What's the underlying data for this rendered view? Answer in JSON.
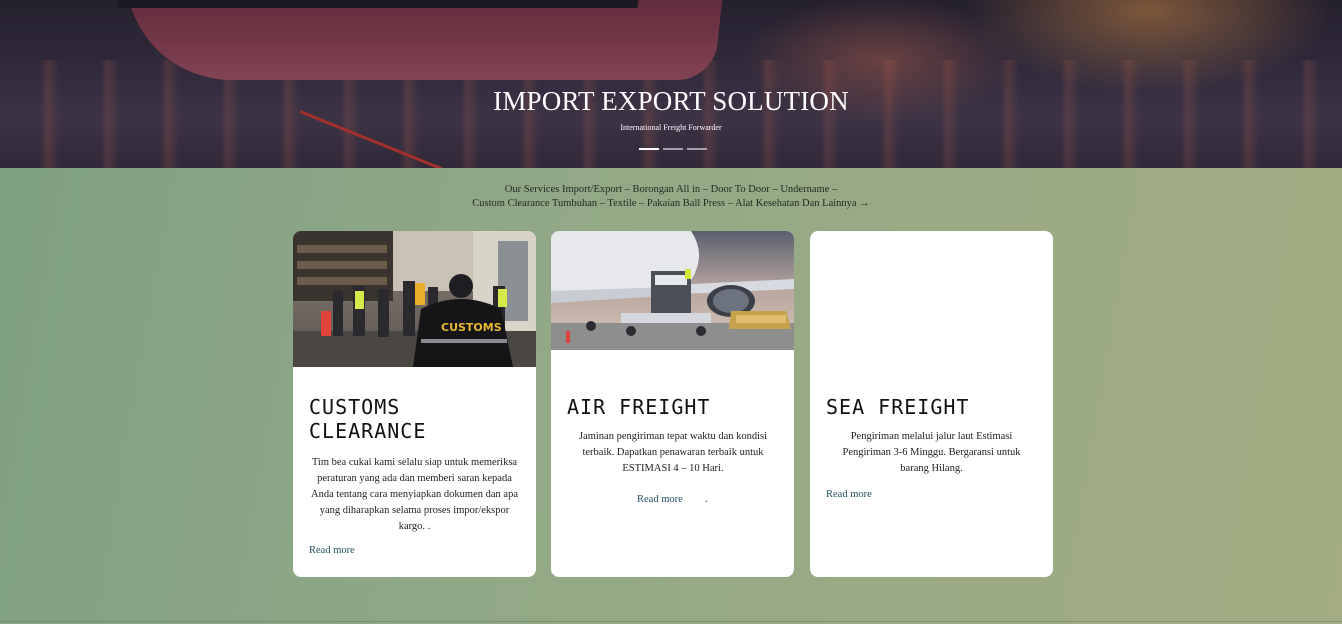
{
  "hero": {
    "title": "IMPORT EXPORT SOLUTION",
    "subtitle": "International Freight Forwarder",
    "slides": [
      true,
      false,
      false
    ]
  },
  "services": {
    "line1": "Our Services Import/Export – Borongan All in – Door To Door – Undername –",
    "line2": "Custom Clearance Tumbuhan – Textile – Pakaian Ball Press – Alat Kesehatan Dan Lainnya →"
  },
  "cards": [
    {
      "title_line1": "CUSTOMS",
      "title_line2": "CLEARANCE",
      "description": "Tim bea cukai kami selalu siap untuk memeriksa peraturan yang ada dan memberi saran kepada Anda tentang cara menyiapkan dokumen dan apa yang diharapkan selama proses impor/ekspor kargo. .",
      "link": "Read more",
      "badge": "CUSTOMS"
    },
    {
      "title": "AIR FREIGHT",
      "description": "Jaminan pengiriman tepat waktu dan kondisi terbaik. Dapatkan penawaran terbaik untuk ESTIMASI 4 – 10 Hari.",
      "link": "Read more",
      "trailing": "."
    },
    {
      "title": "SEA FREIGHT",
      "description": "Pengiriman melalui jalur laut Estimasi Pengiriman 3-6 Minggu. Bergaransi untuk barang Hilang.",
      "link": "Read more"
    }
  ],
  "colors": {
    "accent_link": "#1f4e5f",
    "background_start": "#7fa084",
    "background_end": "#a3ac82"
  }
}
